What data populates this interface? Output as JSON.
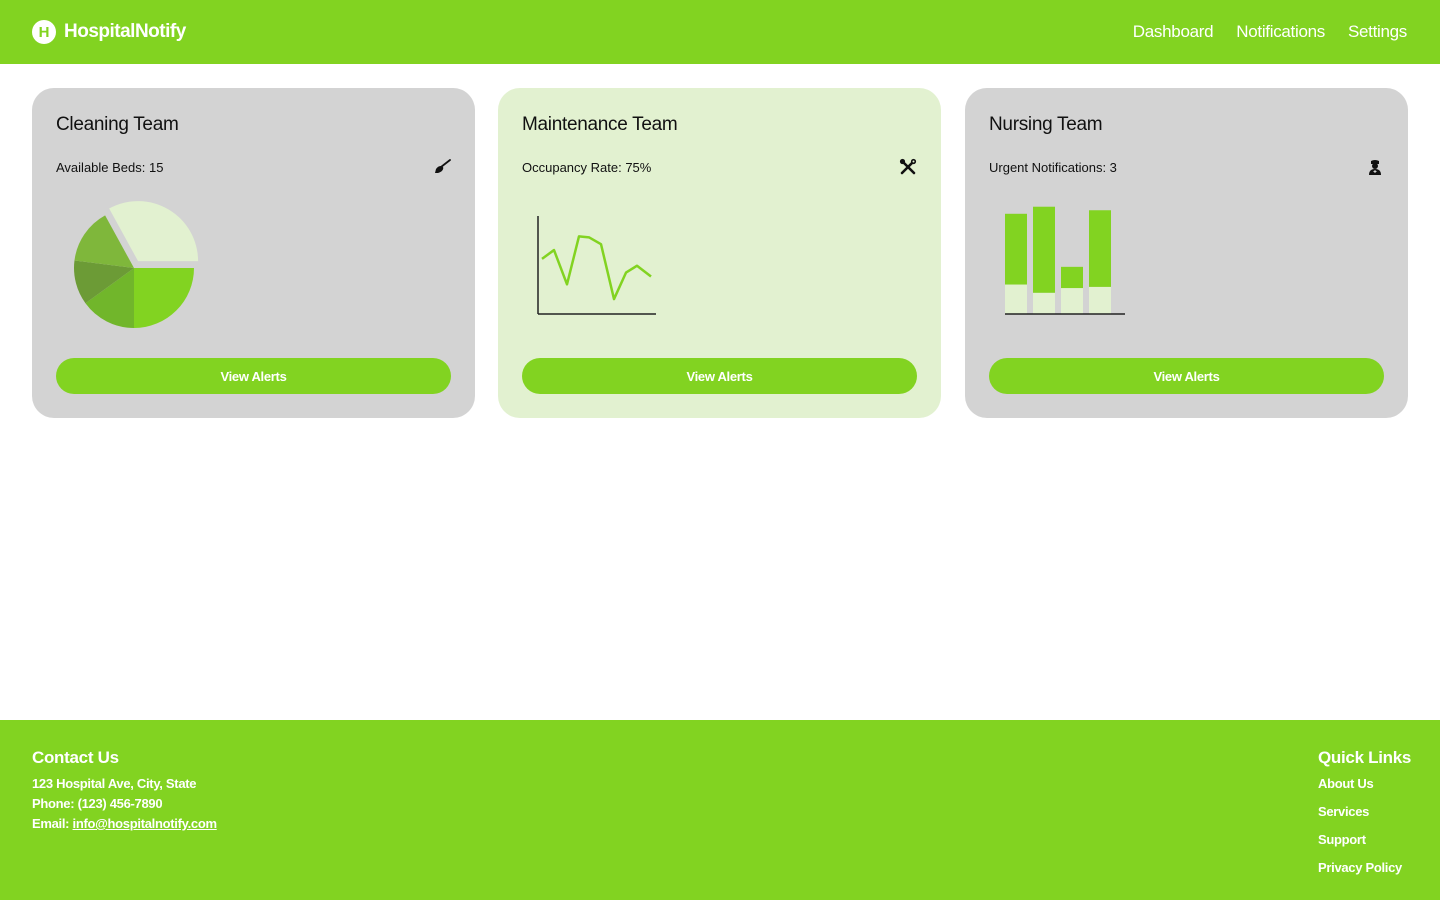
{
  "header": {
    "logo_letter": "H",
    "app_name": "HospitalNotify",
    "nav": [
      "Dashboard",
      "Notifications",
      "Settings"
    ]
  },
  "cards": [
    {
      "title": "Cleaning Team",
      "stat": "Available Beds: 15",
      "icon": "broom-icon",
      "button": "View Alerts",
      "chart_kind": "pie"
    },
    {
      "title": "Maintenance Team",
      "stat": "Occupancy Rate: 75%",
      "icon": "tools-icon",
      "button": "View Alerts",
      "chart_kind": "line"
    },
    {
      "title": "Nursing Team",
      "stat": "Urgent Notifications: 3",
      "icon": "nurse-icon",
      "button": "View Alerts",
      "chart_kind": "stacked-bar"
    }
  ],
  "chart_data": [
    {
      "type": "pie",
      "values": [
        25,
        15,
        12,
        15,
        33
      ],
      "colors": [
        "#82d321",
        "#71b62b",
        "#6c9b36",
        "#7fb73b",
        "#e2f1d0"
      ],
      "exploded": [
        false,
        false,
        false,
        false,
        true
      ]
    },
    {
      "type": "line",
      "x": [
        0,
        1,
        2,
        3,
        4,
        5,
        6,
        7,
        8,
        9,
        10,
        11,
        12
      ],
      "values": [
        44,
        53,
        18,
        67,
        66,
        59,
        3,
        30,
        37,
        26
      ],
      "ylim": [
        0,
        100
      ],
      "color": "#82d321"
    },
    {
      "type": "bar",
      "categories": [
        "1",
        "2",
        "3",
        "4"
      ],
      "series": [
        {
          "values": [
            25,
            18,
            22,
            23
          ],
          "color": "#e2f1d0"
        },
        {
          "values": [
            60,
            73,
            18,
            65
          ],
          "color": "#82d321"
        }
      ],
      "ylim": [
        0,
        95
      ]
    }
  ],
  "colors": {
    "primary": "#82d321",
    "card_gray": "#d3d3d3",
    "card_highlight": "#e2f1d0"
  },
  "footer": {
    "contact_heading": "Contact Us",
    "address": "123 Hospital Ave, City, State",
    "phone": "Phone: (123) 456-7890",
    "email_label": "Email: ",
    "email": "info@hospitalnotify.com",
    "links_heading": "Quick Links",
    "links": [
      "About Us",
      "Services",
      "Support",
      "Privacy Policy"
    ]
  }
}
